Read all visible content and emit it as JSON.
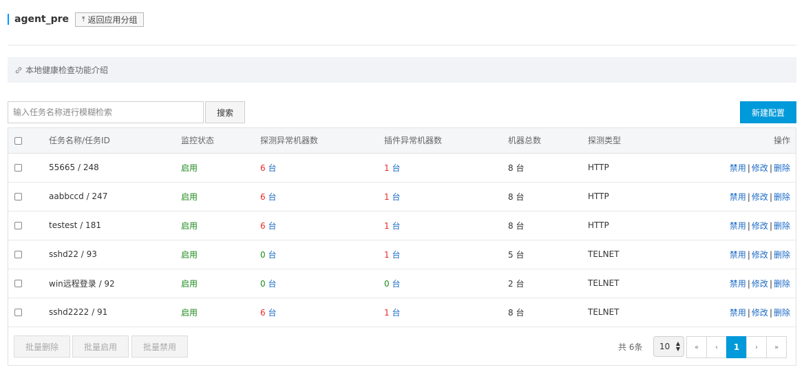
{
  "header": {
    "title": "agent_pre",
    "back_label": "返回应用分组"
  },
  "intro": {
    "label": "本地健康检查功能介绍"
  },
  "search": {
    "placeholder": "输入任务名称进行模糊检索",
    "button_label": "搜索"
  },
  "new_button_label": "新建配置",
  "table": {
    "headers": [
      "任务名称/任务ID",
      "监控状态",
      "探测异常机器数",
      "插件异常机器数",
      "机器总数",
      "探测类型",
      "操作"
    ],
    "unit": "台",
    "rows": [
      {
        "name": "55665 / 248",
        "status": "启用",
        "probe_abnormal": "6",
        "plugin_abnormal": "1",
        "total": "8 台",
        "type": "HTTP"
      },
      {
        "name": "aabbccd / 247",
        "status": "启用",
        "probe_abnormal": "6",
        "plugin_abnormal": "1",
        "total": "8 台",
        "type": "HTTP"
      },
      {
        "name": "testest / 181",
        "status": "启用",
        "probe_abnormal": "6",
        "plugin_abnormal": "1",
        "total": "8 台",
        "type": "HTTP"
      },
      {
        "name": "sshd22 / 93",
        "status": "启用",
        "probe_abnormal": "0",
        "plugin_abnormal": "1",
        "total": "5 台",
        "type": "TELNET"
      },
      {
        "name": "win远程登录 / 92",
        "status": "启用",
        "probe_abnormal": "0",
        "plugin_abnormal": "0",
        "total": "2 台",
        "type": "TELNET"
      },
      {
        "name": "sshd2222 / 91",
        "status": "启用",
        "probe_abnormal": "6",
        "plugin_abnormal": "1",
        "total": "8 台",
        "type": "TELNET"
      }
    ],
    "actions": {
      "disable": "禁用",
      "edit": "修改",
      "delete": "删除",
      "separator": "|"
    }
  },
  "footer": {
    "bulk_delete": "批量删除",
    "bulk_enable": "批量启用",
    "bulk_disable": "批量禁用",
    "total_text": "共 6条",
    "page_size": "10",
    "pager": {
      "first": "«",
      "prev": "‹",
      "current": "1",
      "next": "›",
      "last": "»"
    }
  },
  "colors": {
    "accent": "#0099d9",
    "enabled": "#1e8a1e",
    "alert": "#e52a2a",
    "link": "#1c6bc6"
  }
}
